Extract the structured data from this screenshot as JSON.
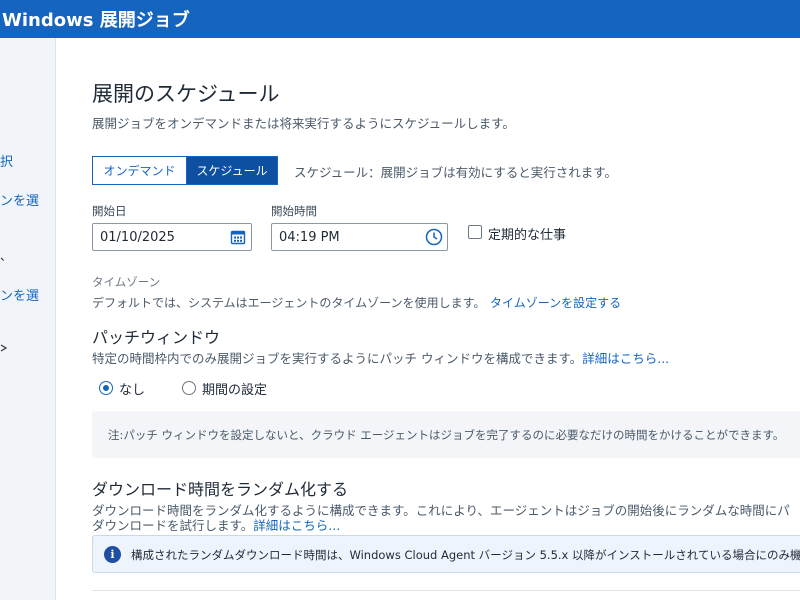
{
  "header": {
    "app_title": "Windows 展開ジョブ"
  },
  "sidebar": {
    "items": [
      {
        "label": "択"
      },
      {
        "label": "ンを選"
      },
      {
        "label": "、"
      },
      {
        "label": "ンを選"
      }
    ]
  },
  "schedule": {
    "title": "展開のスケジュール",
    "subtitle": "展開ジョブをオンデマンドまたは将来実行するようにスケジュールします。",
    "mode_options": [
      {
        "label": "オンデマンド",
        "selected": false
      },
      {
        "label": "スケジュール",
        "selected": true
      }
    ],
    "mode_info": "スケジュール：展開ジョブは有効にすると実行されます。",
    "start_date": {
      "label": "開始日",
      "value": "01/10/2025",
      "icon": "calendar-icon"
    },
    "start_time": {
      "label": "開始時間",
      "value": "04:19 PM",
      "icon": "clock-icon"
    },
    "recurring": {
      "label": "定期的な仕事",
      "checked": false
    },
    "timezone": {
      "label": "タイムゾーン",
      "description": "デフォルトでは、システムはエージェントのタイムゾーンを使用します。",
      "link": "タイムゾーンを設定する"
    }
  },
  "patch_window": {
    "title": "パッチウィンドウ",
    "description": "特定の時間枠内でのみ展開ジョブを実行するようにパッチ ウィンドウを構成できます。",
    "link": "詳細はこちら...",
    "options": [
      {
        "label": "なし",
        "selected": true
      },
      {
        "label": "期間の設定",
        "selected": false
      }
    ],
    "note": "注:パッチ ウィンドウを設定しないと、クラウド エージェントはジョブを完了するのに必要なだけの時間をかけることができます。"
  },
  "randomize": {
    "title": "ダウンロード時間をランダム化する",
    "description_line1": "ダウンロード時間をランダム化するように構成できます。これにより、エージェントはジョブの開始後にランダムな時間にパ",
    "description_line2": "ダウンロードを試行します。",
    "link": "詳細はこちら...",
    "info": "構成されたランダムダウンロード時間は、Windows Cloud Agent バージョン 5.5.x 以降がインストールされている場合にのみ機能します",
    "info_icon": "info-icon"
  },
  "colors": {
    "accent": "#1565c0",
    "header_bg": "#1565c0",
    "selected_segment": "#0d4fa0"
  }
}
